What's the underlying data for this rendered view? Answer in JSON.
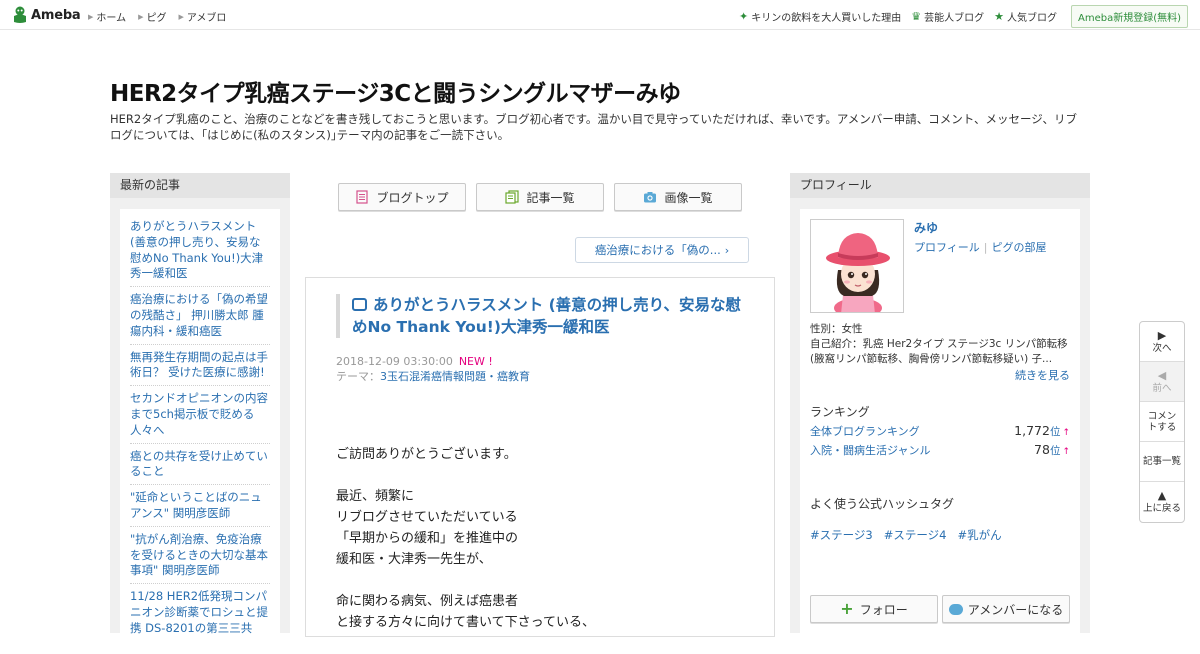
{
  "topbar": {
    "logo": "Ameba",
    "nav": [
      "ホーム",
      "ピグ",
      "アメブロ"
    ],
    "right_links": [
      {
        "icon": "sparkle-icon",
        "label": "キリンの飲料を大人買いした理由"
      },
      {
        "icon": "crown-icon",
        "label": "芸能人ブログ"
      },
      {
        "icon": "star-icon",
        "label": "人気ブログ"
      }
    ],
    "register_label": "Ameba新規登録(無料)"
  },
  "header": {
    "title": "HER2タイプ乳癌ステージ3Cと闘うシングルマザーみゆ",
    "description": "HER2タイプ乳癌のこと、治療のことなどを書き残しておこうと思います。ブログ初心者です。温かい目で見守っていただければ、幸いです。アメンバー申請、コメント、メッセージ、リブログについては、｢はじめに(私のスタンス)｣テーマ内の記事をご一読下さい。"
  },
  "left": {
    "heading": "最新の記事",
    "recent": [
      "ありがとうハラスメント(善意の押し売り、安易な慰めNo Thank You!)大津秀一緩和医",
      "癌治療における「偽の希望の残酷さ」 押川勝太郎 腫瘍内科・緩和癌医",
      "無再発生存期間の起点は手術日？ 受けた医療に感謝!",
      "セカンドオピニオンの内容まで5ch掲示板で貶める人々へ",
      "癌との共存を受け止めていること",
      "\"延命ということばのニュアンス\" 関明彦医師",
      "\"抗がん剤治療、免疫治療を受けるときの大切な基本事項\" 関明彦医師",
      "11/28 HER2低発現コンパニオン診断薬でロシュと提携 DS-8201の第三三共"
    ]
  },
  "center": {
    "tabs": [
      {
        "icon": "document-icon",
        "label": "ブログトップ"
      },
      {
        "icon": "list-icon",
        "label": "記事一覧"
      },
      {
        "icon": "camera-icon",
        "label": "画像一覧"
      }
    ],
    "prev_article": "癌治療における「偽の...",
    "article": {
      "title": "ありがとうハラスメント (善意の押し売り、安易な慰めNo Thank You!)大津秀一緩和医",
      "datetime": "2018-12-09 03:30:00",
      "new_badge": "NEW !",
      "theme_label": "テーマ：",
      "theme": "3玉石混淆癌情報問題・癌教育",
      "paragraphs": [
        [
          "ご訪問ありがとうございます。"
        ],
        [
          "最近、頻繁に",
          "リブログさせていただいている",
          "「早期からの緩和」を推進中の",
          "緩和医・大津秀一先生が、"
        ],
        [
          "命に関わる病気、例えば癌患者",
          "と接する方々に向けて書いて下さっている、"
        ]
      ]
    }
  },
  "right": {
    "heading": "プロフィール",
    "name": "みゆ",
    "link_profile": "プロフィール",
    "link_room": "ピグの部屋",
    "gender": "性別：女性",
    "intro": "自己紹介：乳癌 Her2タイプ ステージ3c リンパ節転移 (腋窩リンパ節転移、胸骨傍リンパ節転移疑い) 子...",
    "more": "続きを見る",
    "ranking_heading": "ランキング",
    "rankings": [
      {
        "label": "全体ブログランキング",
        "value": "1,772",
        "unit": "位",
        "trend": "↑"
      },
      {
        "label": "入院・闘病生活ジャンル",
        "value": "78",
        "unit": "位",
        "trend": "↑"
      }
    ],
    "hashtag_heading": "よく使う公式ハッシュタグ",
    "hashtags": [
      "#ステージ3",
      "#ステージ4",
      "#乳がん"
    ],
    "follow_label": "フォロー",
    "amember_label": "アメンバーになる"
  },
  "floatnav": {
    "next": "次へ",
    "prev": "前へ",
    "comment": "コメントする",
    "list": "記事一覧",
    "top": "上に戻る"
  },
  "colors": {
    "link": "#2a6fb0",
    "brand_green": "#2d8d3a",
    "new_badge": "#e4007f"
  }
}
